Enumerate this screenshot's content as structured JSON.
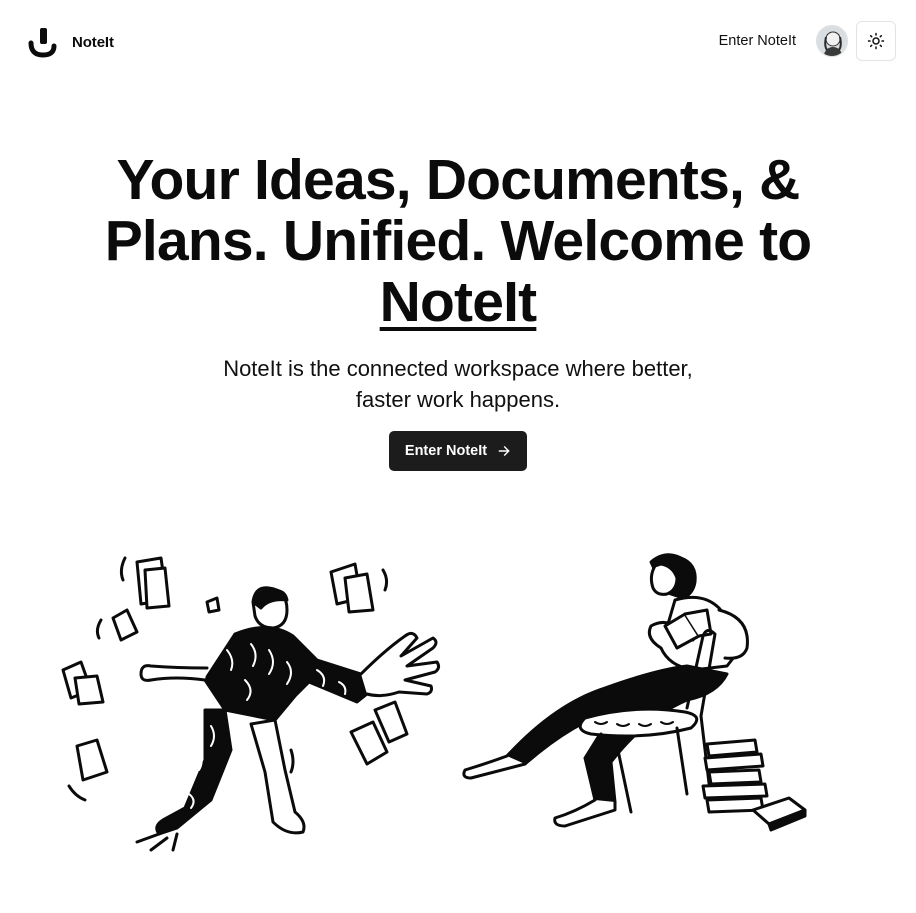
{
  "header": {
    "brand_name": "NoteIt",
    "enter_link": "Enter NoteIt",
    "theme_toggle_icon": "sun-icon",
    "avatar_icon": "user-avatar"
  },
  "hero": {
    "headline_part1": "Your Ideas, Documents, & Plans. Unified. Welcome to ",
    "headline_brand": "NoteIt",
    "subtitle": "NoteIt is the connected workspace where better, faster work happens.",
    "cta_label": "Enter NoteIt",
    "cta_icon": "arrow-right-icon"
  },
  "illustrations": {
    "left": "stressed-man-papers-illustration",
    "right": "woman-reading-chair-illustration"
  },
  "colors": {
    "text": "#0b0b0b",
    "button_bg": "#1c1c1c",
    "button_text": "#ffffff",
    "border": "#e3e3e3"
  }
}
